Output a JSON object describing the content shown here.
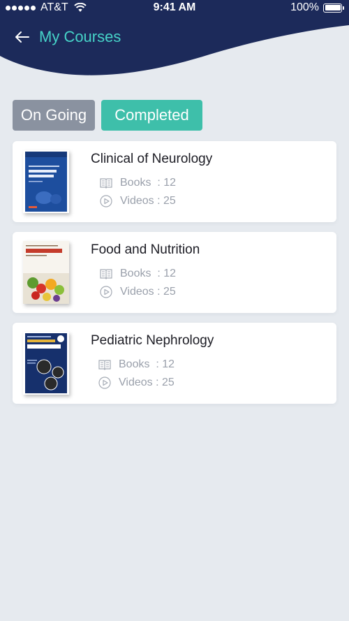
{
  "status_bar": {
    "carrier": "AT&T",
    "time": "9:41 AM",
    "battery": "100%",
    "battery_level": 1.0
  },
  "header": {
    "title": "My Courses",
    "back_icon": "arrow-left-icon"
  },
  "tabs": [
    {
      "label": "On Going",
      "active": false
    },
    {
      "label": "Completed",
      "active": true
    }
  ],
  "courses": [
    {
      "title": "Clinical of Neurology",
      "books": "Books  : 12",
      "videos": "Videos : 25"
    },
    {
      "title": "Food and Nutrition",
      "books": "Books  : 12",
      "videos": "Videos : 25"
    },
    {
      "title": "Pediatric Nephrology",
      "books": "Books  : 12",
      "videos": "Videos : 25"
    }
  ],
  "icons": {
    "books": "book-icon",
    "videos": "play-circle-icon"
  },
  "colors": {
    "header_bg": "#1c2a5a",
    "title_accent": "#46d3c8",
    "tab_inactive": "#8a92a0",
    "tab_active": "#3ebfaa",
    "page_bg": "#e6eaef"
  }
}
